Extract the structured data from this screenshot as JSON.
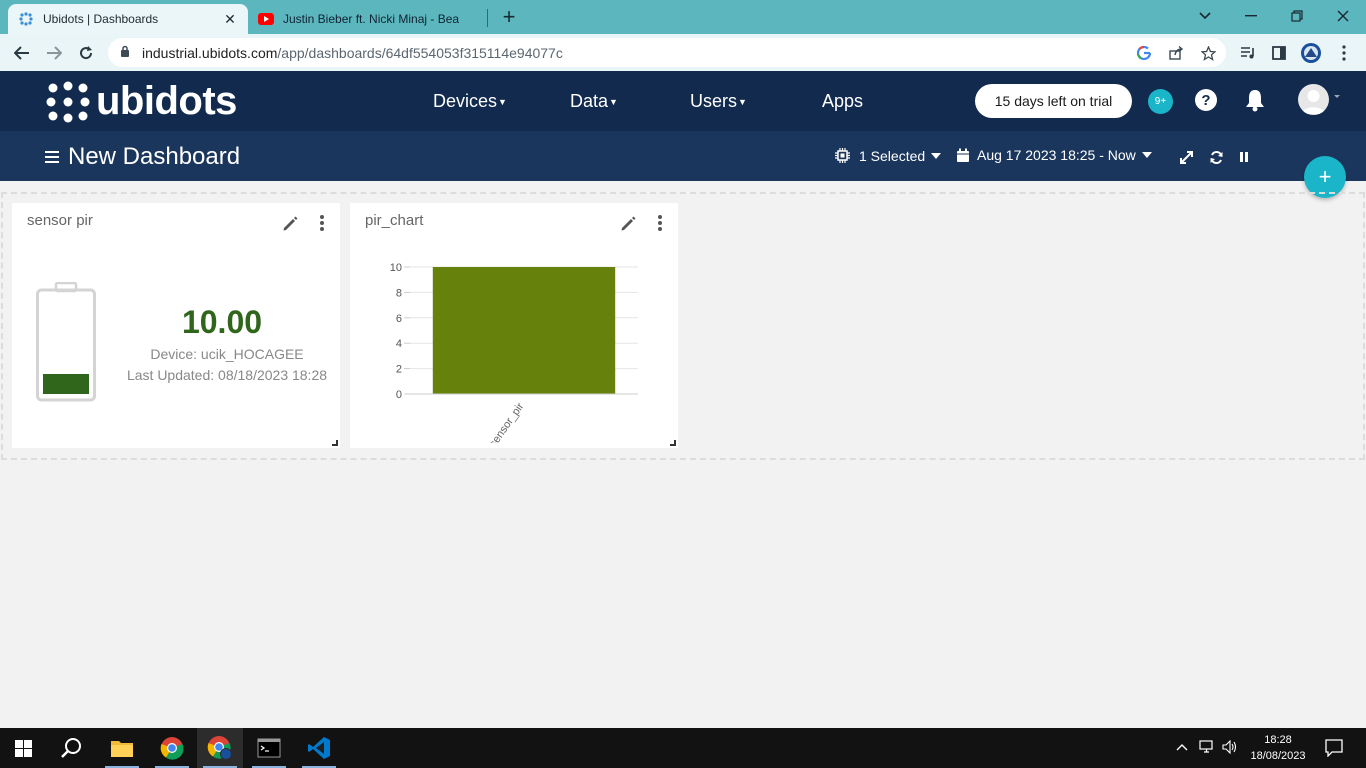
{
  "browser": {
    "tabs": [
      {
        "title": "Ubidots | Dashboards",
        "favicon": "ubidots-favicon-icon",
        "active": true
      },
      {
        "title": "Justin Bieber ft. Nicki Minaj - Bea",
        "favicon": "youtube-icon",
        "active": false
      }
    ],
    "url_host": "industrial.ubidots.com",
    "url_path": "/app/dashboards/64df554053f315114e94077c"
  },
  "app": {
    "logo_text": "ubidots",
    "nav": [
      {
        "label": "Devices",
        "has_dropdown": true
      },
      {
        "label": "Data",
        "has_dropdown": true
      },
      {
        "label": "Users",
        "has_dropdown": true
      },
      {
        "label": "Apps",
        "has_dropdown": false
      }
    ],
    "trial_label": "15 days left on trial",
    "notifications_badge": "9+",
    "help_label": "?"
  },
  "dashboard": {
    "title": "New Dashboard",
    "device_selector": "1 Selected",
    "date_range": "Aug 17 2023 18:25 - Now",
    "add_button": "+"
  },
  "widgets": [
    {
      "title": "sensor pir",
      "type": "battery",
      "value": "10.00",
      "device_line": "Device: ucik_HOCAGEE",
      "updated_line": "Last Updated: 08/18/2023 18:28",
      "level_fraction": 0.2,
      "color": "#30661c"
    },
    {
      "title": "pir_chart",
      "type": "bar"
    }
  ],
  "chart_data": {
    "type": "bar",
    "categories": [
      "sensor_pir"
    ],
    "values": [
      10
    ],
    "ylim": [
      0,
      10
    ],
    "yticks": [
      "0",
      "2",
      "4",
      "6",
      "8",
      "10"
    ],
    "color": "#66820c",
    "grid": true
  },
  "taskbar": {
    "apps": [
      "windows-start-icon",
      "search-icon",
      "file-explorer-icon",
      "chrome-icon",
      "chrome-profile-icon",
      "terminal-icon",
      "vscode-icon"
    ],
    "time": "18:28",
    "date": "18/08/2023"
  },
  "colors": {
    "header": "#112a4d",
    "dashbar": "#1b365d",
    "accent": "#1ab5c9",
    "tabstrip": "#5bb6bd"
  }
}
